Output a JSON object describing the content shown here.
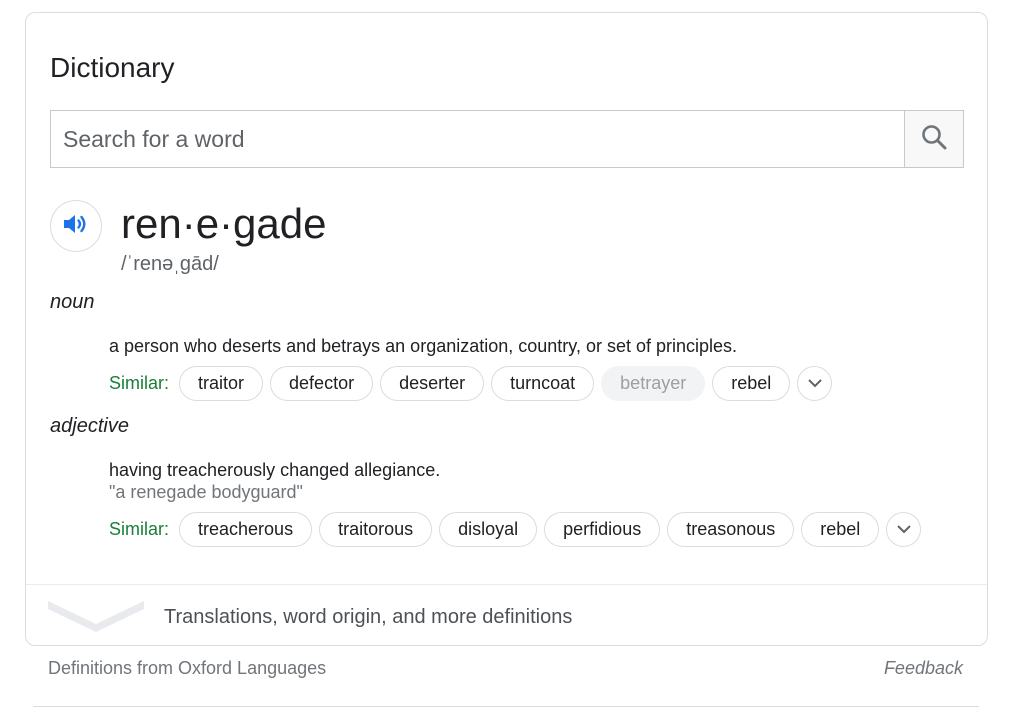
{
  "card": {
    "title": "Dictionary"
  },
  "search": {
    "placeholder": "Search for a word",
    "value": ""
  },
  "entry": {
    "headword": "ren·e·gade",
    "phonetic": "/ˈrenəˌɡād/",
    "senses": [
      {
        "pos": "noun",
        "definition": "a person who deserts and betrays an organization, country, or set of principles.",
        "example": "",
        "similar_label": "Similar:",
        "similar": [
          {
            "word": "traitor",
            "muted": false
          },
          {
            "word": "defector",
            "muted": false
          },
          {
            "word": "deserter",
            "muted": false
          },
          {
            "word": "turncoat",
            "muted": false
          },
          {
            "word": "betrayer",
            "muted": true
          },
          {
            "word": "rebel",
            "muted": false
          }
        ]
      },
      {
        "pos": "adjective",
        "definition": "having treacherously changed allegiance.",
        "example": "\"a renegade bodyguard\"",
        "similar_label": "Similar:",
        "similar": [
          {
            "word": "treacherous",
            "muted": false
          },
          {
            "word": "traitorous",
            "muted": false
          },
          {
            "word": "disloyal",
            "muted": false
          },
          {
            "word": "perfidious",
            "muted": false
          },
          {
            "word": "treasonous",
            "muted": false
          },
          {
            "word": "rebel",
            "muted": false
          }
        ]
      }
    ]
  },
  "more": {
    "label": "Translations, word origin, and more definitions"
  },
  "footer": {
    "source": "Definitions from Oxford Languages",
    "feedback": "Feedback"
  },
  "icons": {
    "search": "search-icon",
    "audio": "speaker-icon",
    "expand": "chevron-down-icon",
    "more": "chevron-down-icon"
  },
  "colors": {
    "similar_label": "#188038",
    "audio": "#1a73e8",
    "muted_chip_bg": "#f1f3f4"
  }
}
